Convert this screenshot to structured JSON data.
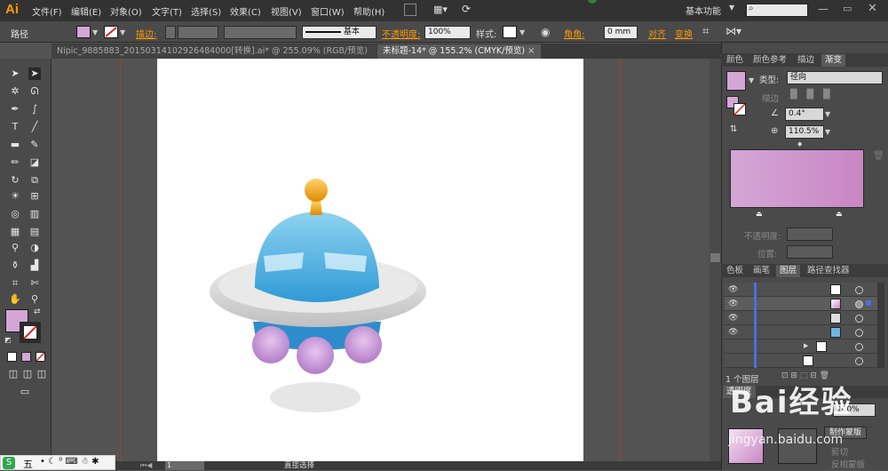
{
  "app": {
    "logo": "Ai"
  },
  "menu": {
    "items": [
      "文件(F)",
      "编辑(E)",
      "对象(O)",
      "文字(T)",
      "选择(S)",
      "效果(C)",
      "视图(V)",
      "窗口(W)",
      "帮助(H)"
    ],
    "workspace": "基本功能"
  },
  "control": {
    "selection_label": "路径",
    "stroke_label": "描边:",
    "brush_label": "基本",
    "opacity_label": "不透明度:",
    "opacity_value": "100%",
    "style_label": "样式:",
    "corner_label": "角角:",
    "corner_value": "0 mm",
    "align_label": "对齐",
    "transform_label": "变换"
  },
  "tabs": [
    {
      "label": "Nipic_9885883_20150314102926484000[转换].ai* @ 255.09% (RGB/预览)"
    },
    {
      "label": "未标题-14* @ 155.2% (CMYK/预览)"
    }
  ],
  "panels": {
    "top_tabs": [
      "颜色",
      "颜色参考",
      "描边",
      "渐变"
    ],
    "gradient": {
      "type_label": "类型:",
      "type_value": "径向",
      "stroke_label": "描边",
      "angle_value": "0.4°",
      "aspect_value": "110.5%",
      "opacity_label": "不透明度:",
      "position_label": "位置:",
      "start_color": "#d4a6d6",
      "end_color": "#c986c4"
    },
    "mid_tabs": [
      "色板",
      "画笔",
      "图层",
      "路径查找器"
    ],
    "layers_count": "1 个图层",
    "bottom_tabs": [
      "透明度"
    ],
    "transparency": {
      "opacity_value": "100%",
      "make_mask_label": "制作蒙版",
      "clip_label": "剪切",
      "invert_label": "反相蒙版"
    }
  },
  "status": {
    "zoom_value": "1",
    "tool_name": "直接选择"
  },
  "ime": {
    "label": "五"
  },
  "watermark": {
    "main": "Bai经验",
    "sub": "jingyan.baidu.com"
  },
  "colors": {
    "accent_orange": "#ff9a00",
    "ufo_dome": "#5bb8e0",
    "ufo_saucer": "#d9d9d9",
    "ufo_pods": "#c99ad6",
    "ufo_base": "#2f8ccc",
    "antenna_ball": "#f0a818"
  }
}
